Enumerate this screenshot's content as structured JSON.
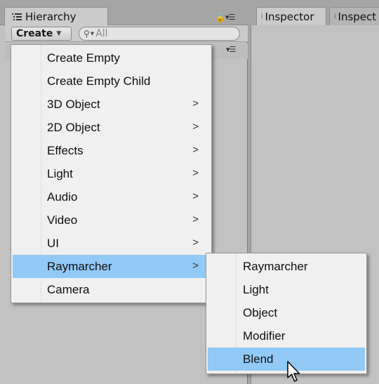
{
  "hierarchy": {
    "tab_label": "Hierarchy",
    "create_label": "Create",
    "search_placeholder": "All"
  },
  "inspector": {
    "tab_label": "Inspector",
    "second_tab_label": "Inspect"
  },
  "create_menu": {
    "items": [
      {
        "label": "Create Empty",
        "has_submenu": false
      },
      {
        "label": "Create Empty Child",
        "has_submenu": false
      },
      {
        "label": "3D Object",
        "has_submenu": true
      },
      {
        "label": "2D Object",
        "has_submenu": true
      },
      {
        "label": "Effects",
        "has_submenu": true
      },
      {
        "label": "Light",
        "has_submenu": true
      },
      {
        "label": "Audio",
        "has_submenu": true
      },
      {
        "label": "Video",
        "has_submenu": true
      },
      {
        "label": "UI",
        "has_submenu": true
      },
      {
        "label": "Raymarcher",
        "has_submenu": true,
        "highlighted": true
      },
      {
        "label": "Camera",
        "has_submenu": false
      }
    ],
    "arrow_glyph": ">"
  },
  "raymarcher_submenu": {
    "items": [
      {
        "label": "Raymarcher"
      },
      {
        "label": "Light"
      },
      {
        "label": "Object"
      },
      {
        "label": "Modifier"
      },
      {
        "label": "Blend",
        "highlighted": true
      }
    ]
  },
  "colors": {
    "highlight": "#91c9f7",
    "menu_bg": "#f0f0f0",
    "panel_bg": "#c2c2c2"
  }
}
